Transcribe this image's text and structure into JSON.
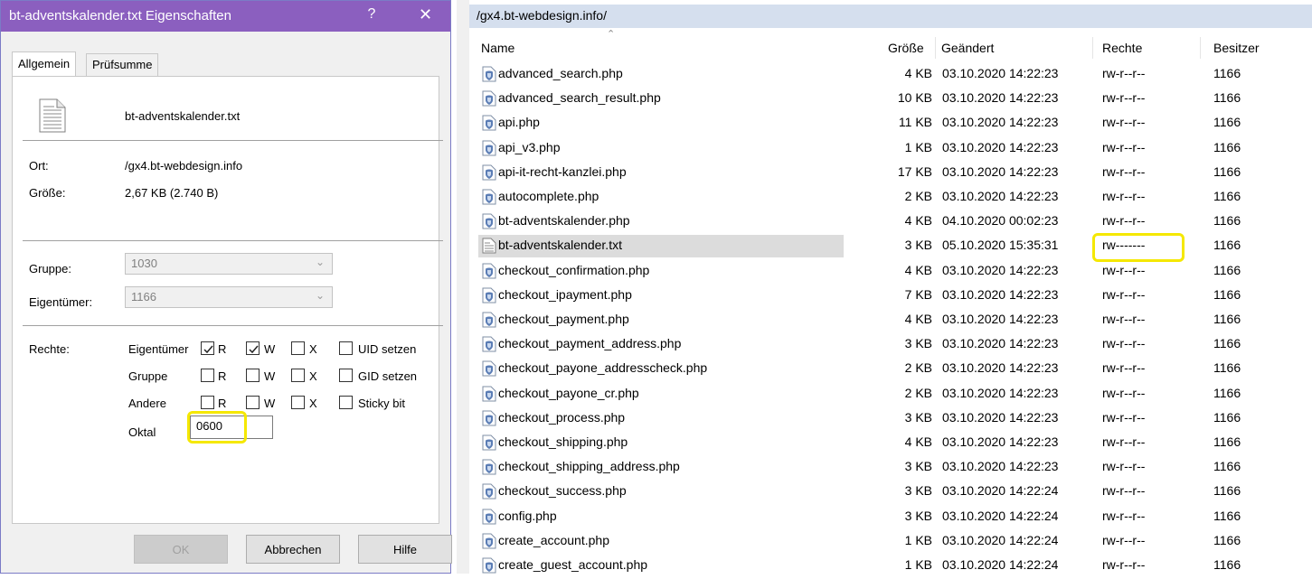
{
  "dialog": {
    "title": "bt-adventskalender.txt Eigenschaften",
    "help_label": "?",
    "close_label": "✕",
    "tabs": [
      {
        "label": "Allgemein",
        "active": true
      },
      {
        "label": "Prüfsumme",
        "active": false
      }
    ],
    "file_name": "bt-adventskalender.txt",
    "location_label": "Ort:",
    "location_value": "/gx4.bt-webdesign.info",
    "size_label": "Größe:",
    "size_value": "2,67 KB (2.740 B)",
    "group_label": "Gruppe:",
    "group_value": "1030",
    "owner_label": "Eigentümer:",
    "owner_value": "1166",
    "rights_label": "Rechte:",
    "perm_rows": [
      {
        "label": "Eigentümer",
        "r": true,
        "w": true,
        "x": false,
        "extra": "UID setzen",
        "extra_checked": false
      },
      {
        "label": "Gruppe",
        "r": false,
        "w": false,
        "x": false,
        "extra": "GID setzen",
        "extra_checked": false
      },
      {
        "label": "Andere",
        "r": false,
        "w": false,
        "x": false,
        "extra": "Sticky bit",
        "extra_checked": false
      }
    ],
    "perm_letters": {
      "r": "R",
      "w": "W",
      "x": "X"
    },
    "octal_label": "Oktal",
    "octal_value": "0600",
    "buttons": {
      "ok": "OK",
      "cancel": "Abbrechen",
      "help": "Hilfe"
    },
    "highlight_color": "#f5e800",
    "title_color": "#8b5fbf"
  },
  "filelist": {
    "path": "/gx4.bt-webdesign.info/",
    "columns": {
      "name": "Name",
      "size": "Größe",
      "modified": "Geändert",
      "rights": "Rechte",
      "owner": "Besitzer"
    },
    "files": [
      {
        "name": "advanced_search.php",
        "size": "4 KB",
        "modified": "03.10.2020 14:22:23",
        "rights": "rw-r--r--",
        "owner": "1166",
        "icon": "php-file-icon"
      },
      {
        "name": "advanced_search_result.php",
        "size": "10 KB",
        "modified": "03.10.2020 14:22:23",
        "rights": "rw-r--r--",
        "owner": "1166",
        "icon": "php-file-icon"
      },
      {
        "name": "api.php",
        "size": "11 KB",
        "modified": "03.10.2020 14:22:23",
        "rights": "rw-r--r--",
        "owner": "1166",
        "icon": "php-file-icon"
      },
      {
        "name": "api_v3.php",
        "size": "1 KB",
        "modified": "03.10.2020 14:22:23",
        "rights": "rw-r--r--",
        "owner": "1166",
        "icon": "php-file-icon"
      },
      {
        "name": "api-it-recht-kanzlei.php",
        "size": "17 KB",
        "modified": "03.10.2020 14:22:23",
        "rights": "rw-r--r--",
        "owner": "1166",
        "icon": "php-file-icon"
      },
      {
        "name": "autocomplete.php",
        "size": "2 KB",
        "modified": "03.10.2020 14:22:23",
        "rights": "rw-r--r--",
        "owner": "1166",
        "icon": "php-file-icon"
      },
      {
        "name": "bt-adventskalender.php",
        "size": "4 KB",
        "modified": "04.10.2020 00:02:23",
        "rights": "rw-r--r--",
        "owner": "1166",
        "icon": "php-file-icon"
      },
      {
        "name": "bt-adventskalender.txt",
        "size": "3 KB",
        "modified": "05.10.2020 15:35:31",
        "rights": "rw-------",
        "owner": "1166",
        "icon": "text-file-icon",
        "selected": true,
        "highlight": true
      },
      {
        "name": "checkout_confirmation.php",
        "size": "4 KB",
        "modified": "03.10.2020 14:22:23",
        "rights": "rw-r--r--",
        "owner": "1166",
        "icon": "php-file-icon"
      },
      {
        "name": "checkout_ipayment.php",
        "size": "7 KB",
        "modified": "03.10.2020 14:22:23",
        "rights": "rw-r--r--",
        "owner": "1166",
        "icon": "php-file-icon"
      },
      {
        "name": "checkout_payment.php",
        "size": "4 KB",
        "modified": "03.10.2020 14:22:23",
        "rights": "rw-r--r--",
        "owner": "1166",
        "icon": "php-file-icon"
      },
      {
        "name": "checkout_payment_address.php",
        "size": "3 KB",
        "modified": "03.10.2020 14:22:23",
        "rights": "rw-r--r--",
        "owner": "1166",
        "icon": "php-file-icon"
      },
      {
        "name": "checkout_payone_addresscheck.php",
        "size": "2 KB",
        "modified": "03.10.2020 14:22:23",
        "rights": "rw-r--r--",
        "owner": "1166",
        "icon": "php-file-icon"
      },
      {
        "name": "checkout_payone_cr.php",
        "size": "2 KB",
        "modified": "03.10.2020 14:22:23",
        "rights": "rw-r--r--",
        "owner": "1166",
        "icon": "php-file-icon"
      },
      {
        "name": "checkout_process.php",
        "size": "3 KB",
        "modified": "03.10.2020 14:22:23",
        "rights": "rw-r--r--",
        "owner": "1166",
        "icon": "php-file-icon"
      },
      {
        "name": "checkout_shipping.php",
        "size": "4 KB",
        "modified": "03.10.2020 14:22:23",
        "rights": "rw-r--r--",
        "owner": "1166",
        "icon": "php-file-icon"
      },
      {
        "name": "checkout_shipping_address.php",
        "size": "3 KB",
        "modified": "03.10.2020 14:22:23",
        "rights": "rw-r--r--",
        "owner": "1166",
        "icon": "php-file-icon"
      },
      {
        "name": "checkout_success.php",
        "size": "3 KB",
        "modified": "03.10.2020 14:22:24",
        "rights": "rw-r--r--",
        "owner": "1166",
        "icon": "php-file-icon"
      },
      {
        "name": "config.php",
        "size": "3 KB",
        "modified": "03.10.2020 14:22:24",
        "rights": "rw-r--r--",
        "owner": "1166",
        "icon": "php-file-icon"
      },
      {
        "name": "create_account.php",
        "size": "1 KB",
        "modified": "03.10.2020 14:22:24",
        "rights": "rw-r--r--",
        "owner": "1166",
        "icon": "php-file-icon"
      },
      {
        "name": "create_guest_account.php",
        "size": "1 KB",
        "modified": "03.10.2020 14:22:24",
        "rights": "rw-r--r--",
        "owner": "1166",
        "icon": "php-file-icon"
      }
    ]
  }
}
